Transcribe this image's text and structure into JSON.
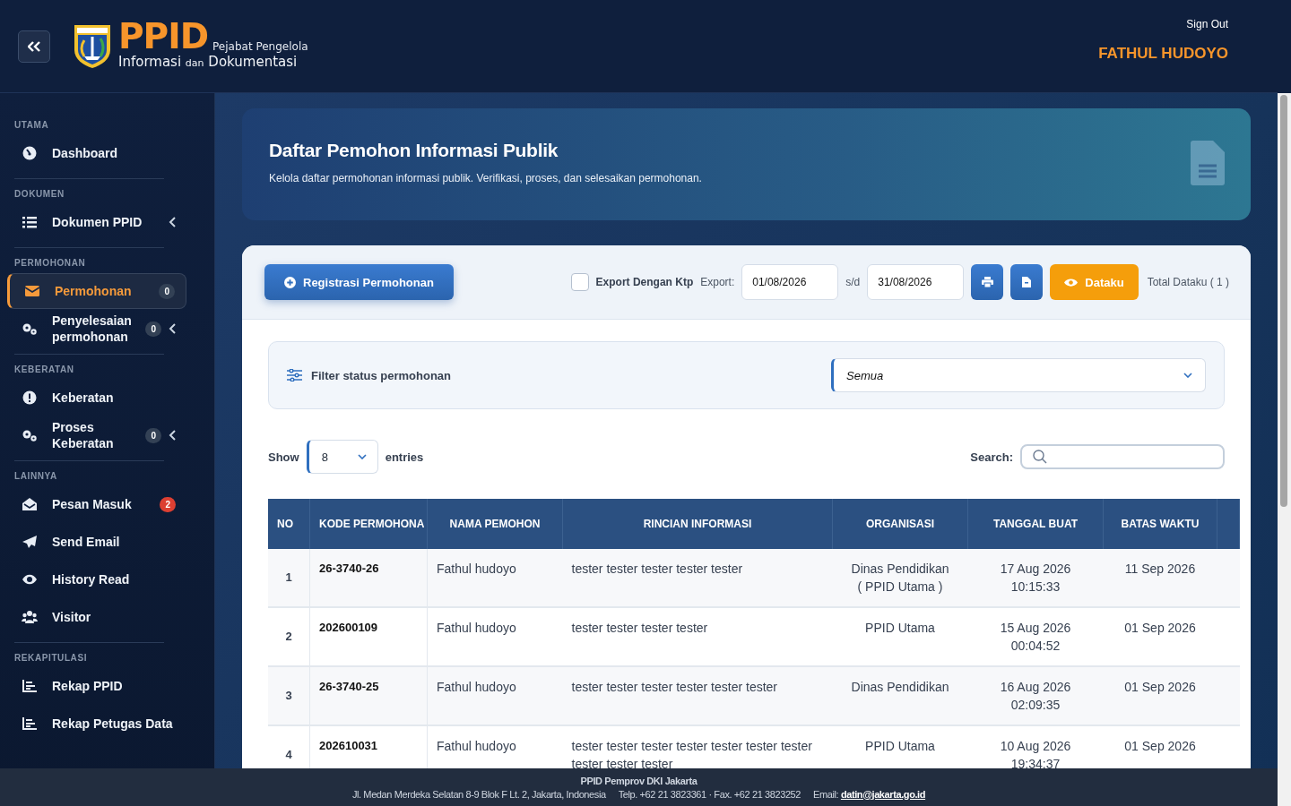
{
  "header": {
    "logo": {
      "title": "PPID",
      "tagline": "Pejabat Pengelola",
      "line_a": "Informasi",
      "line_conj": "dan",
      "line_b": "Dokumentasi"
    },
    "sign_out": "Sign Out",
    "user_name": "FATHUL HUDOYO"
  },
  "sidebar": [
    {
      "heading": "UTAMA",
      "items": [
        {
          "label": "Dashboard",
          "kind": "gauge",
          "selected": false,
          "submenu": false
        }
      ]
    },
    {
      "heading": "DOKUMEN",
      "items": [
        {
          "label": "Dokumen PPID",
          "kind": "list",
          "selected": false,
          "submenu": true
        }
      ]
    },
    {
      "heading": "PERMOHONAN",
      "items": [
        {
          "label": "Permohonan",
          "kind": "envelope",
          "selected": true,
          "submenu": false,
          "badge": "0",
          "color": "#334155"
        },
        {
          "label": "Penyelesaian permohonan",
          "kind": "cogs",
          "selected": false,
          "submenu": true,
          "badge": "0",
          "color": "#334155"
        }
      ]
    },
    {
      "heading": "KEBERATAN",
      "items": [
        {
          "label": "Keberatan",
          "kind": "alert",
          "selected": false,
          "submenu": false
        },
        {
          "label": "Proses Keberatan",
          "kind": "cogs",
          "selected": false,
          "submenu": true,
          "badge": "0",
          "color": "#334155"
        }
      ]
    },
    {
      "heading": "LAINNYA",
      "items": [
        {
          "label": "Pesan Masuk",
          "kind": "envelope-open",
          "selected": false,
          "submenu": false,
          "badge": "2",
          "color": "#dc3f32"
        },
        {
          "label": "Send Email",
          "kind": "send",
          "selected": false,
          "submenu": false
        },
        {
          "label": "History Read",
          "kind": "eye",
          "selected": false,
          "submenu": false
        },
        {
          "label": "Visitor",
          "kind": "users",
          "selected": false,
          "submenu": false
        }
      ]
    },
    {
      "heading": "REKAPITULASI",
      "items": [
        {
          "label": "Rekap PPID",
          "kind": "chart",
          "selected": false,
          "submenu": false
        },
        {
          "label": "Rekap Petugas Data",
          "kind": "chart",
          "selected": false,
          "submenu": false
        }
      ]
    }
  ],
  "banner": {
    "title": "Daftar Pemohon Informasi Publik",
    "subtitle": "Kelola daftar permohonan informasi publik. Verifikasi, proses, dan selesaikan permohonan."
  },
  "toolbar": {
    "register_button": "Registrasi Permohonan",
    "export_ktp": {
      "label": "Export Dengan Ktp",
      "checked": false
    },
    "export_label": "Export:",
    "date_from": "01/08/2026",
    "range_sep": "s/d",
    "date_to": "31/08/2026",
    "dataku_button": "Dataku",
    "total": "Total Dataku ( 1 )"
  },
  "filter": {
    "label": "Filter status permohonan",
    "value": "Semua"
  },
  "entries": {
    "show": "Show",
    "value": "8",
    "suffix": "entries",
    "search_label": "Search:"
  },
  "table": {
    "columns": [
      "NO",
      "KODE PERMOHONA",
      "NAMA PEMOHON",
      "RINCIAN INFORMASI",
      "ORGANISASI",
      "TANGGAL BUAT",
      "BATAS WAKTU"
    ],
    "rows": [
      {
        "no": "1",
        "code": "26-3740-26",
        "name": "Fathul hudoyo",
        "detail": "tester tester tester tester tester",
        "org": [
          "Dinas Pendidikan",
          "( PPID Utama )"
        ],
        "created": [
          "17 Aug 2026",
          "10:15:33"
        ],
        "deadline": "11 Sep 2026"
      },
      {
        "no": "2",
        "code": "202600109",
        "name": "Fathul hudoyo",
        "detail": "tester tester tester tester",
        "org": [
          "PPID Utama"
        ],
        "created": [
          "15 Aug 2026",
          "00:04:52"
        ],
        "deadline": "01 Sep 2026"
      },
      {
        "no": "3",
        "code": "26-3740-25",
        "name": "Fathul hudoyo",
        "detail": "tester tester tester tester tester tester",
        "org": [
          "Dinas Pendidikan"
        ],
        "created": [
          "16 Aug 2026",
          "02:09:35"
        ],
        "deadline": "01 Sep 2026"
      },
      {
        "no": "4",
        "code": "202610031",
        "name": "Fathul hudoyo",
        "detail": "tester tester tester tester tester tester tester tester tester tester",
        "org": [
          "PPID Utama"
        ],
        "created": [
          "10 Aug 2026",
          "19:34:37"
        ],
        "deadline": "01 Sep 2026"
      }
    ]
  },
  "footer": {
    "title": "PPID Pemprov DKI Jakarta",
    "address": "Jl. Medan Merdeka Selatan 8-9 Blok F Lt. 2, Jakarta, Indonesia",
    "phone": "Telp. +62 21 3823361 · Fax. +62 21 3823252",
    "email_label": "Email:",
    "email": "datin@jakarta.go.id"
  }
}
